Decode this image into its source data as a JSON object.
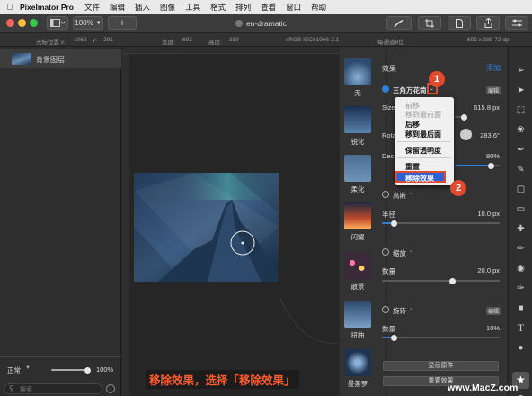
{
  "menubar": {
    "app": "Pixelmator Pro",
    "items": [
      "文件",
      "编辑",
      "插入",
      "图像",
      "工具",
      "格式",
      "排列",
      "查看",
      "窗口",
      "帮助"
    ]
  },
  "toolbar": {
    "zoom": "100%",
    "add": "+",
    "doc_title": "en-dramatic"
  },
  "info": {
    "cursor_label": "光标位置 x:",
    "x": "1062",
    "y_label": "y:",
    "y": "-291",
    "width_label": "宽度:",
    "width": "692",
    "height_label": "高度:",
    "height": "389",
    "colorspace": "sRGB IEC61966-2.1",
    "depth": "每通道8位",
    "size": "692 x 389 72 dpi"
  },
  "layers": {
    "items": [
      {
        "name": "背景图层"
      }
    ],
    "blend": "正常",
    "opacity": "100%",
    "opacity_level": 1.0,
    "search_placeholder": "搜索"
  },
  "effects_browser": {
    "items": [
      "无",
      "锐化",
      "柔化",
      "闪耀",
      "散景",
      "扭曲",
      "曼荼罗"
    ]
  },
  "props": {
    "header": "效果",
    "add": "添加",
    "effect1": {
      "name": "三角万花筒",
      "badge": "编辑",
      "size_label": "Size",
      "size_value": "615.8 px",
      "rot_label": "Rota",
      "rot_value": "283.6°",
      "dec_label": "Dec",
      "dec_value": "80%",
      "dec_level": 0.8
    },
    "effect2": {
      "name": "高斯",
      "radius_label": "半径",
      "radius_value": "10.0 px",
      "radius_level": 0.1
    },
    "effect3": {
      "name": "缩放",
      "amount_label": "数量",
      "amount_value": "20.0 px",
      "amount_level": 0.6
    },
    "effect4": {
      "name": "旋转",
      "badge": "编辑",
      "amount_label": "数量",
      "amount_value": "10%",
      "amount_level": 0.1
    },
    "show_original": "显示原件",
    "reset": "重置效果"
  },
  "context_menu": {
    "items": [
      {
        "label": "前移",
        "enabled": false
      },
      {
        "label": "移到最前面",
        "enabled": false
      },
      {
        "label": "后移",
        "enabled": true
      },
      {
        "label": "移到最后面",
        "enabled": true
      },
      {
        "label": "保留透明度",
        "enabled": true
      },
      {
        "label": "重置",
        "enabled": true
      },
      {
        "label": "移除效果",
        "enabled": true,
        "selected": true
      }
    ]
  },
  "annotations": {
    "badge1": "1",
    "badge2": "2",
    "caption": "移除效果，选择「移除效果」"
  },
  "watermark": "www.MacZ.com",
  "colors": {
    "accent": "#2f7fdc",
    "badge": "#e24a2d",
    "highlight_box": "#e24a2d"
  }
}
